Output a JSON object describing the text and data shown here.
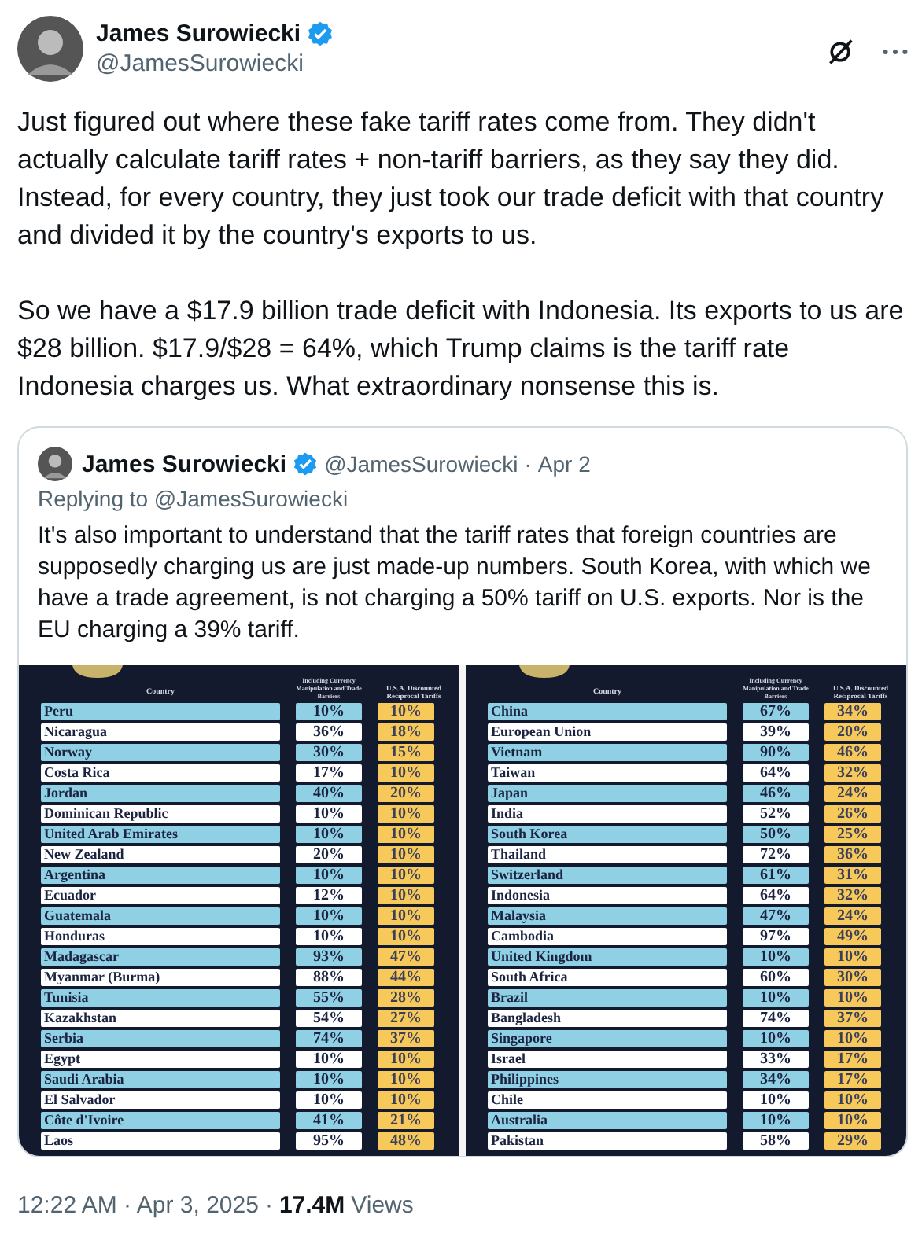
{
  "author": {
    "name": "James Surowiecki",
    "handle": "@JamesSurowiecki",
    "verified": true
  },
  "body": [
    "Just figured out where these fake tariff rates come from. They didn't actually calculate tariff rates + non-tariff barriers, as they say they did. Instead, for every country, they just took our trade deficit with that country and divided it by the country's exports to us.",
    "So we have a $17.9 billion trade deficit with Indonesia. Its exports to us are $28 billion. $17.9/$28 = 64%, which Trump claims is the tariff rate Indonesia charges us. What extraordinary nonsense this is."
  ],
  "quote": {
    "name": "James Surowiecki",
    "verified": true,
    "handle": "@JamesSurowiecki",
    "separator": "·",
    "date": "Apr 2",
    "replying_to": "Replying to @JamesSurowiecki",
    "text": "It's also important to understand that the tariff rates that foreign countries are supposedly charging us are just made-up numbers. South Korea, with which we have a trade agreement, is not charging a 50% tariff on U.S. exports. Nor is the EU charging a 39% tariff.",
    "tables": [
      {
        "columns": [
          "Country",
          "Including Currency Manipulation and Trade Barriers",
          "U.S.A. Discounted Reciprocal Tariffs"
        ],
        "rows": [
          [
            "Peru",
            "10%",
            "10%"
          ],
          [
            "Nicaragua",
            "36%",
            "18%"
          ],
          [
            "Norway",
            "30%",
            "15%"
          ],
          [
            "Costa Rica",
            "17%",
            "10%"
          ],
          [
            "Jordan",
            "40%",
            "20%"
          ],
          [
            "Dominican Republic",
            "10%",
            "10%"
          ],
          [
            "United Arab Emirates",
            "10%",
            "10%"
          ],
          [
            "New Zealand",
            "20%",
            "10%"
          ],
          [
            "Argentina",
            "10%",
            "10%"
          ],
          [
            "Ecuador",
            "12%",
            "10%"
          ],
          [
            "Guatemala",
            "10%",
            "10%"
          ],
          [
            "Honduras",
            "10%",
            "10%"
          ],
          [
            "Madagascar",
            "93%",
            "47%"
          ],
          [
            "Myanmar (Burma)",
            "88%",
            "44%"
          ],
          [
            "Tunisia",
            "55%",
            "28%"
          ],
          [
            "Kazakhstan",
            "54%",
            "27%"
          ],
          [
            "Serbia",
            "74%",
            "37%"
          ],
          [
            "Egypt",
            "10%",
            "10%"
          ],
          [
            "Saudi Arabia",
            "10%",
            "10%"
          ],
          [
            "El Salvador",
            "10%",
            "10%"
          ],
          [
            "Côte d'Ivoire",
            "41%",
            "21%"
          ],
          [
            "Laos",
            "95%",
            "48%"
          ]
        ]
      },
      {
        "columns": [
          "Country",
          "Including Currency Manipulation and Trade Barriers",
          "U.S.A. Discounted Reciprocal Tariffs"
        ],
        "rows": [
          [
            "China",
            "67%",
            "34%"
          ],
          [
            "European Union",
            "39%",
            "20%"
          ],
          [
            "Vietnam",
            "90%",
            "46%"
          ],
          [
            "Taiwan",
            "64%",
            "32%"
          ],
          [
            "Japan",
            "46%",
            "24%"
          ],
          [
            "India",
            "52%",
            "26%"
          ],
          [
            "South Korea",
            "50%",
            "25%"
          ],
          [
            "Thailand",
            "72%",
            "36%"
          ],
          [
            "Switzerland",
            "61%",
            "31%"
          ],
          [
            "Indonesia",
            "64%",
            "32%"
          ],
          [
            "Malaysia",
            "47%",
            "24%"
          ],
          [
            "Cambodia",
            "97%",
            "49%"
          ],
          [
            "United Kingdom",
            "10%",
            "10%"
          ],
          [
            "South Africa",
            "60%",
            "30%"
          ],
          [
            "Brazil",
            "10%",
            "10%"
          ],
          [
            "Bangladesh",
            "74%",
            "37%"
          ],
          [
            "Singapore",
            "10%",
            "10%"
          ],
          [
            "Israel",
            "33%",
            "17%"
          ],
          [
            "Philippines",
            "34%",
            "17%"
          ],
          [
            "Chile",
            "10%",
            "10%"
          ],
          [
            "Australia",
            "10%",
            "10%"
          ],
          [
            "Pakistan",
            "58%",
            "29%"
          ]
        ]
      }
    ]
  },
  "footer": {
    "time": "12:22 AM · Apr 3, 2025",
    "separator": "·",
    "views_count": "17.4M",
    "views_label": "Views"
  }
}
